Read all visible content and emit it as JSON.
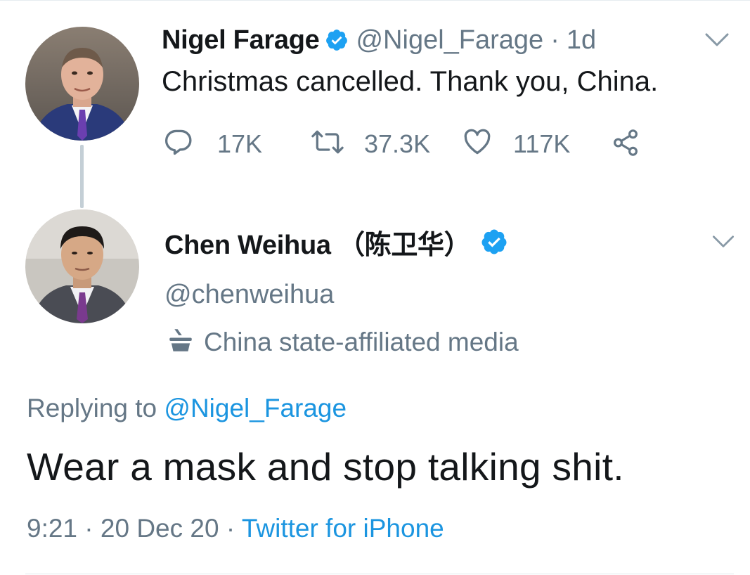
{
  "parent_tweet": {
    "display_name": "Nigel Farage",
    "handle": "@Nigel_Farage",
    "separator": "·",
    "age": "1d",
    "text": "Christmas cancelled. Thank you, China.",
    "replies": "17K",
    "retweets": "37.3K",
    "likes": "117K",
    "verified": true
  },
  "reply_tweet": {
    "display_name": "Chen Weihua （陈卫华）",
    "handle": "@chenweihua",
    "label": "China state-affiliated media",
    "replying_prefix": "Replying to",
    "replying_to": "@Nigel_Farage",
    "text": "Wear a mask and stop talking shit.",
    "time": "9:21",
    "sep1": "·",
    "date": "20 Dec 20",
    "sep2": "·",
    "source": "Twitter for iPhone",
    "verified": true
  },
  "colors": {
    "text": "#14171a",
    "secondary": "#657786",
    "link": "#1b95e0",
    "verified": "#1da1f2",
    "divider": "#e1e8ed"
  },
  "icons": [
    "reply-icon",
    "retweet-icon",
    "like-icon",
    "share-icon",
    "chevron-down-icon",
    "verified-badge-icon",
    "state-media-icon"
  ]
}
